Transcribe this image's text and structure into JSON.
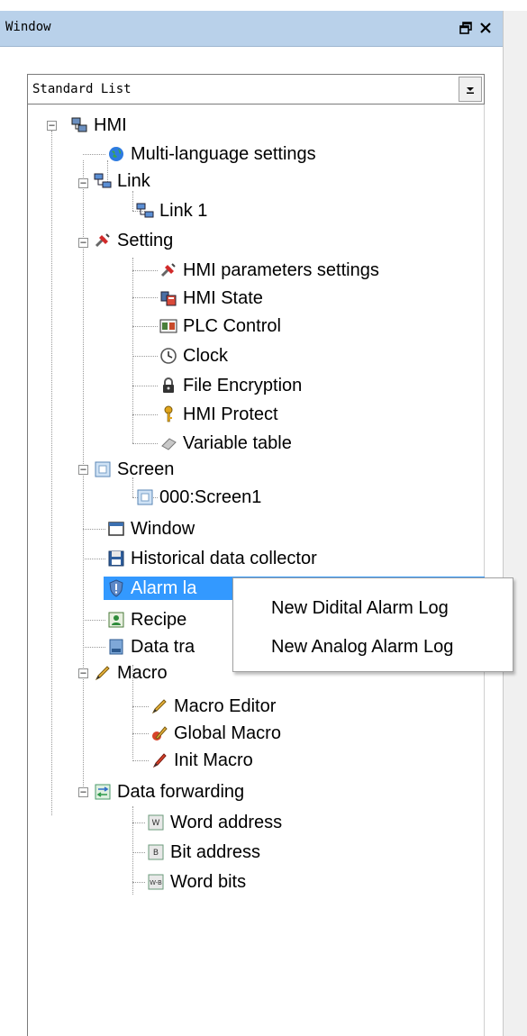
{
  "window": {
    "title": "Window"
  },
  "combo": {
    "value": "Standard List"
  },
  "tree": {
    "root": "HMI",
    "multilang": "Multi-language settings",
    "link": "Link",
    "link1": "Link 1",
    "setting": "Setting",
    "hmi_params": "HMI parameters settings",
    "hmi_state": "HMI State",
    "plc_control": "PLC Control",
    "clock": "Clock",
    "file_encryption": "File Encryption",
    "hmi_protect": "HMI Protect",
    "variable_table": "Variable table",
    "screen": "Screen",
    "screen1": "000:Screen1",
    "window": "Window",
    "historical": "Historical data collector",
    "alarm": "Alarm la",
    "recipe": "Recipe",
    "data_transfer": "Data tra",
    "macro": "Macro",
    "macro_editor": "Macro Editor",
    "global_macro": "Global Macro",
    "init_macro": "Init Macro",
    "data_forwarding": "Data forwarding",
    "word_address": "Word address",
    "bit_address": "Bit address",
    "word_bits": "Word bits"
  },
  "context_menu": {
    "new_digital": "New Didital Alarm Log",
    "new_analog": "New Analog Alarm Log"
  },
  "icons": {
    "float": "restore-window-icon",
    "close": "close-icon",
    "dropdown": "chevron-down-icon"
  },
  "colors": {
    "titlebar": "#b9d1ea",
    "selection": "#3399ff"
  }
}
